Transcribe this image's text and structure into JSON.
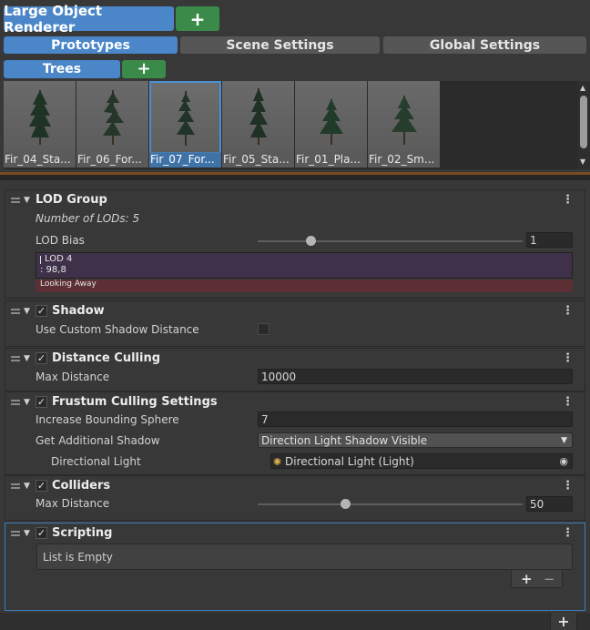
{
  "toolbar": {
    "title": "Large Object Renderer",
    "add_label": "+"
  },
  "tabs": [
    {
      "label": "Prototypes"
    },
    {
      "label": "Scene Settings"
    },
    {
      "label": "Global Settings"
    }
  ],
  "category": {
    "label": "Trees",
    "add_label": "+"
  },
  "prototypes": [
    {
      "label": "Fir_04_Sta..."
    },
    {
      "label": "Fir_06_For..."
    },
    {
      "label": "Fir_07_For..."
    },
    {
      "label": "Fir_05_Sta..."
    },
    {
      "label": "Fir_01_Pla..."
    },
    {
      "label": "Fir_02_Sm..."
    }
  ],
  "selected_prototype": 2,
  "lod_group": {
    "title": "LOD Group",
    "count_label": "Number of LODs: 5",
    "bias_label": "LOD Bias",
    "bias_value": "1",
    "bias_fraction": 0.2,
    "lod_name": "LOD 4",
    "lod_percent": ": 98,8",
    "looking_away": "Looking Away"
  },
  "shadow": {
    "title": "Shadow",
    "custom_distance_label": "Use Custom Shadow Distance"
  },
  "distance_culling": {
    "title": "Distance Culling",
    "max_distance_label": "Max Distance",
    "max_distance_value": "10000"
  },
  "frustum": {
    "title": "Frustum Culling Settings",
    "sphere_label": "Increase Bounding Sphere",
    "sphere_value": "7",
    "shadow_label": "Get Additional Shadow",
    "shadow_value": "Direction Light Shadow Visible",
    "light_label": "Directional Light",
    "light_value": "Directional Light (Light)"
  },
  "colliders": {
    "title": "Colliders",
    "max_distance_label": "Max Distance",
    "max_distance_value": "50",
    "distance_fraction": 0.33
  },
  "scripting": {
    "title": "Scripting",
    "empty_label": "List is Empty",
    "add_label": "+",
    "remove_label": "−"
  },
  "footer": {
    "add_label": "+"
  },
  "colors": {
    "accent_blue": "#4a86c8",
    "add_green": "#3a8b4a",
    "selection": "#3d7fbf",
    "divider": "#7a4a22"
  }
}
